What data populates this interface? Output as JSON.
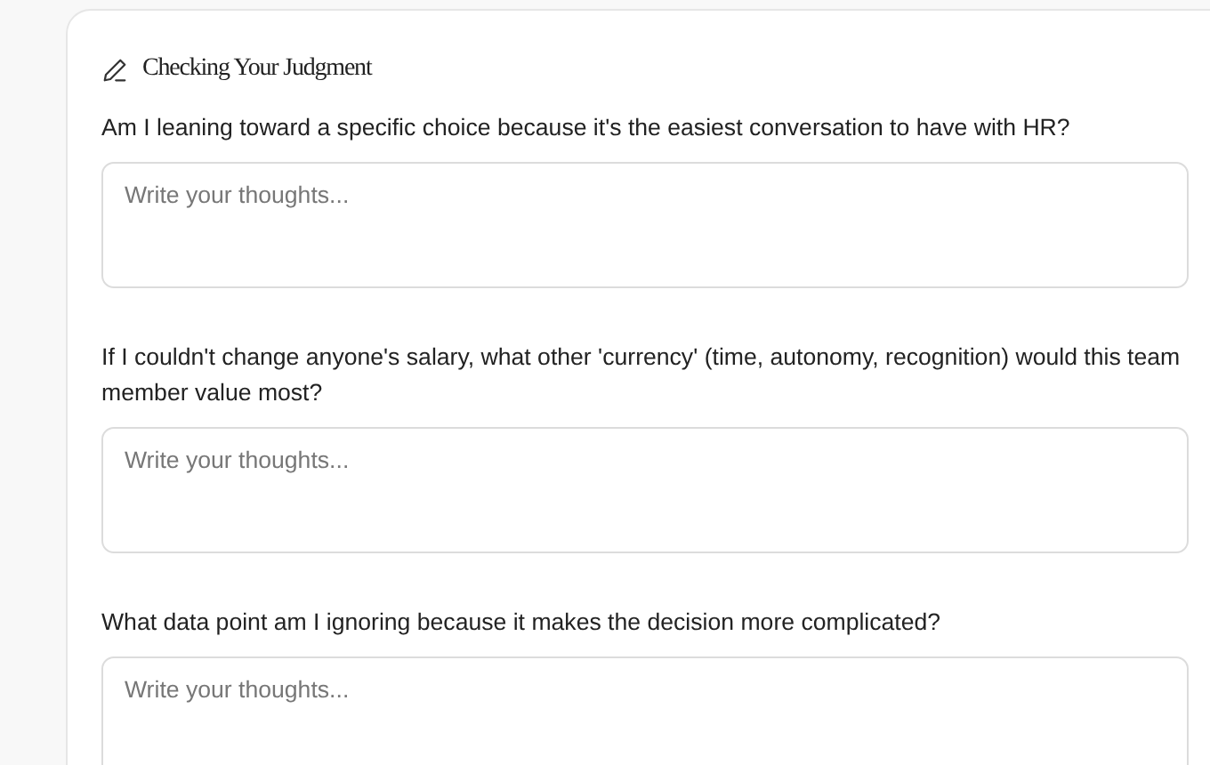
{
  "section": {
    "title": "Checking Your Judgment"
  },
  "questions": [
    {
      "prompt": "Am I leaning toward a specific choice because it's the easiest conversation to have with HR?",
      "placeholder": "Write your thoughts..."
    },
    {
      "prompt": "If I couldn't change anyone's salary, what other 'currency' (time, autonomy, recognition) would this team member value most?",
      "placeholder": "Write your thoughts..."
    },
    {
      "prompt": "What data point am I ignoring because it makes the decision more complicated?",
      "placeholder": "Write your thoughts..."
    }
  ]
}
